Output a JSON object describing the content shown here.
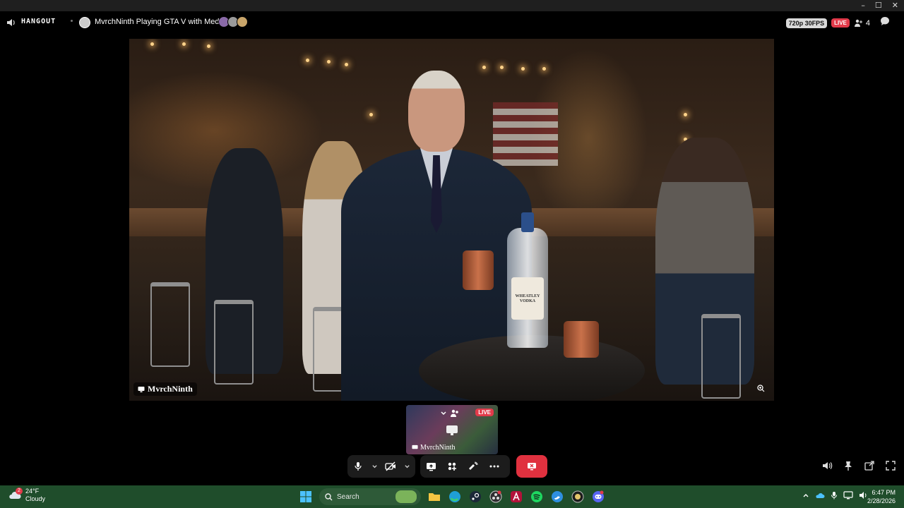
{
  "window": {
    "controls": [
      "–",
      "☐",
      "✕"
    ]
  },
  "topbar": {
    "brand": "HANGOUT",
    "activity": "MvrchNinth Playing GTA V with Medal",
    "quality": "720p 30FPS",
    "live": "LIVE",
    "participant_count": "4"
  },
  "stage": {
    "streamer_name": "MvrchNinth",
    "bottle_label": "WHEATLEY VODKA"
  },
  "thumbnail": {
    "live": "LIVE",
    "name": "MvrchNinth"
  },
  "taskbar": {
    "temperature": "24°F",
    "condition": "Cloudy",
    "weather_badge": "2",
    "search_placeholder": "Search",
    "time": "6:47 PM",
    "date": "2/28/2026"
  },
  "colors": {
    "live_red": "#e23a4a",
    "leave_red": "#e0313f",
    "taskbar_green": "#1f4d2b"
  }
}
